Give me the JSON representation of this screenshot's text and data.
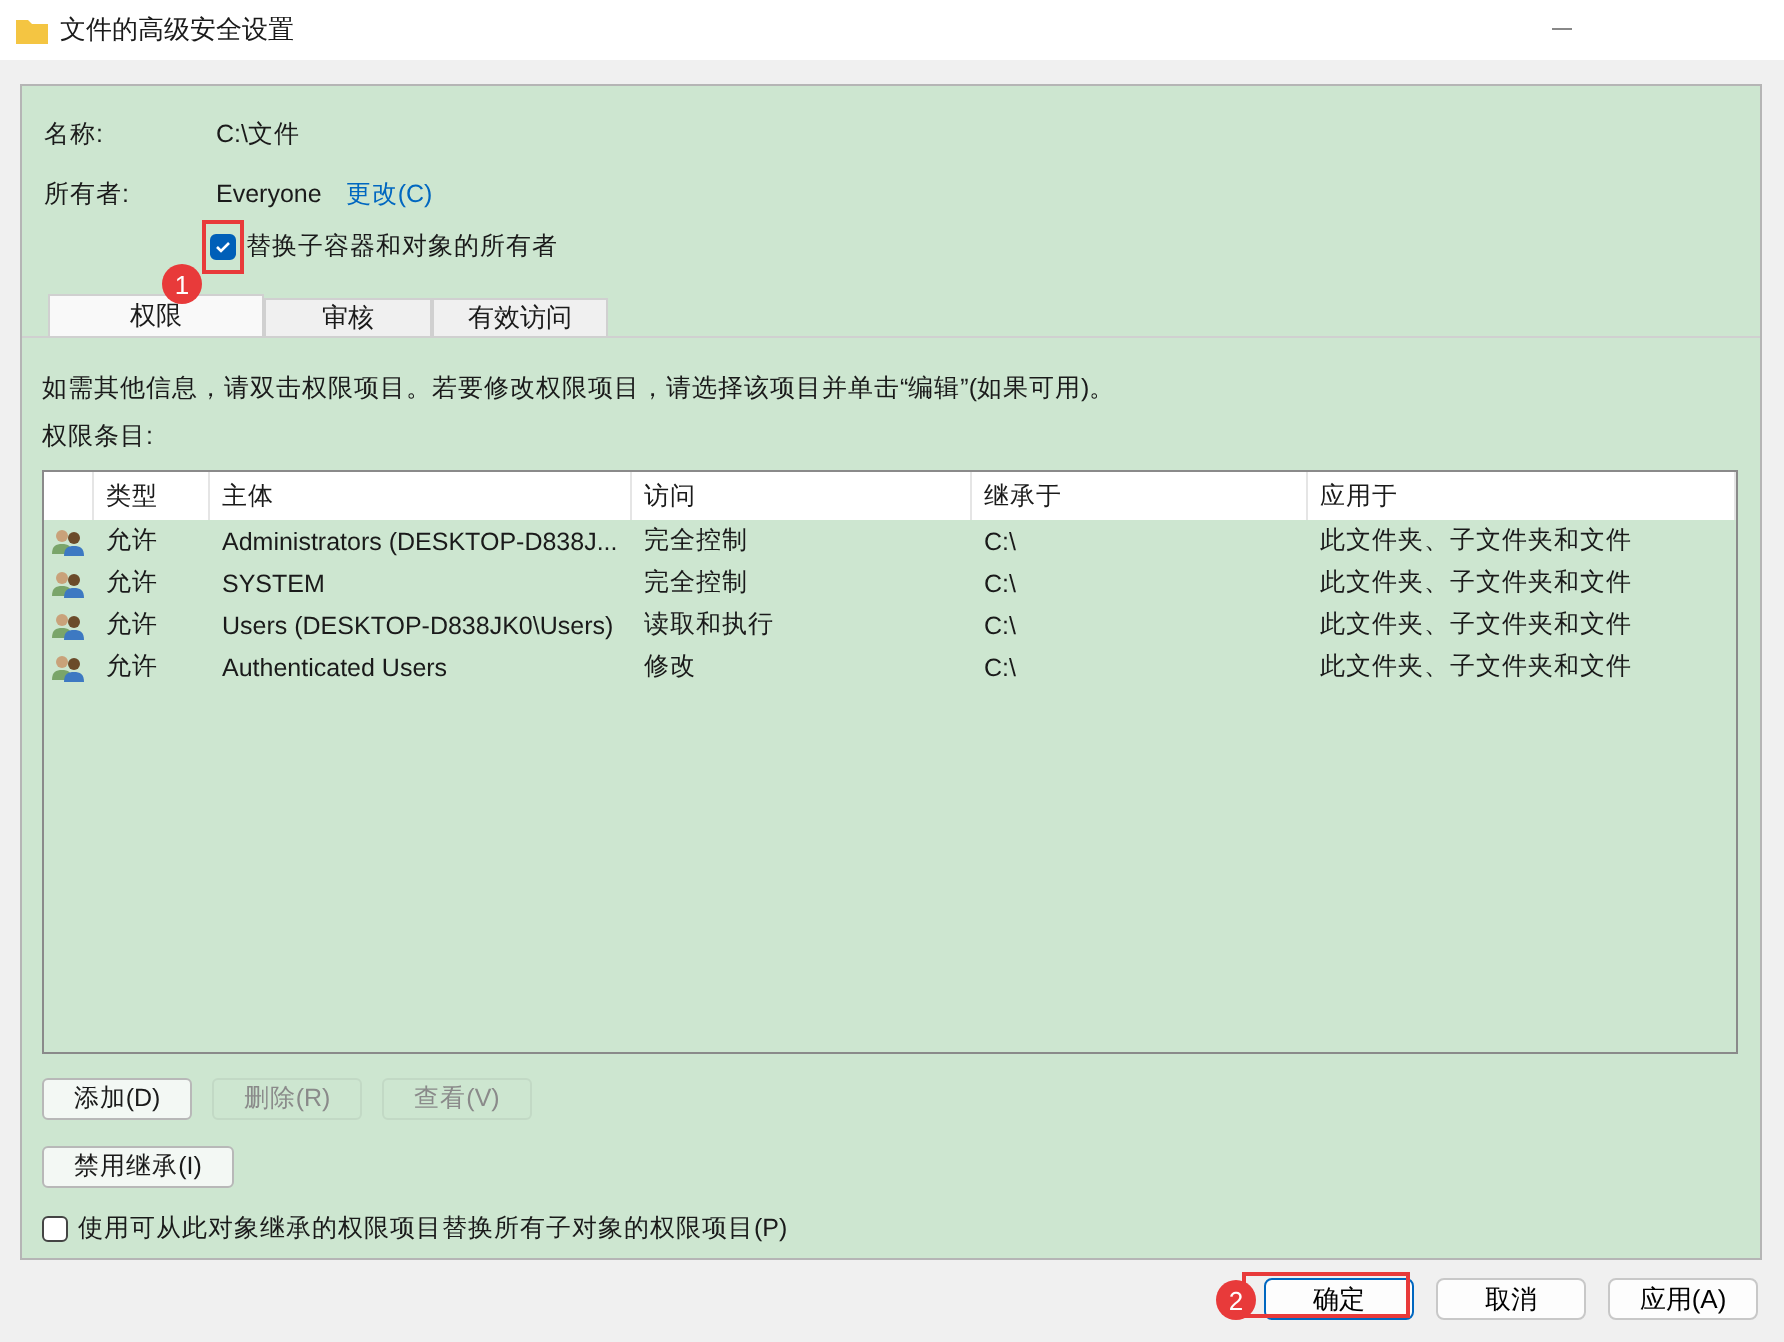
{
  "window": {
    "title": "文件的高级安全设置"
  },
  "name_row": {
    "label": "名称:",
    "value": "C:\\文件"
  },
  "owner_row": {
    "label": "所有者:",
    "value": "Everyone",
    "link": "更改(C)"
  },
  "replace_owner": {
    "label": "替换子容器和对象的所有者",
    "checked": true,
    "annotation": "1"
  },
  "tabs": [
    {
      "label": "权限",
      "selected": true
    },
    {
      "label": "审核",
      "selected": false
    },
    {
      "label": "有效访问",
      "selected": false
    }
  ],
  "description": "如需其他信息，请双击权限项目。若要修改权限项目，请选择该项目并单击“编辑”(如果可用)。",
  "entries_label": "权限条目:",
  "table": {
    "columns": [
      "类型",
      "主体",
      "访问",
      "继承于",
      "应用于"
    ],
    "rows": [
      {
        "type": "允许",
        "principal": "Administrators (DESKTOP-D838J...",
        "access": "完全控制",
        "inherited_from": "C:\\",
        "applies_to": "此文件夹、子文件夹和文件"
      },
      {
        "type": "允许",
        "principal": "SYSTEM",
        "access": "完全控制",
        "inherited_from": "C:\\",
        "applies_to": "此文件夹、子文件夹和文件"
      },
      {
        "type": "允许",
        "principal": "Users (DESKTOP-D838JK0\\Users)",
        "access": "读取和执行",
        "inherited_from": "C:\\",
        "applies_to": "此文件夹、子文件夹和文件"
      },
      {
        "type": "允许",
        "principal": "Authenticated Users",
        "access": "修改",
        "inherited_from": "C:\\",
        "applies_to": "此文件夹、子文件夹和文件"
      }
    ]
  },
  "entry_buttons": [
    {
      "label": "添加(D)",
      "disabled": false
    },
    {
      "label": "删除(R)",
      "disabled": true
    },
    {
      "label": "查看(V)",
      "disabled": true
    }
  ],
  "inheritance_button": {
    "label": "禁用继承(I)"
  },
  "replace_children": {
    "label": "使用可从此对象继承的权限项目替换所有子对象的权限项目(P)",
    "checked": false
  },
  "footer_buttons": [
    {
      "label": "确定",
      "default": true,
      "annotation": "2"
    },
    {
      "label": "取消",
      "default": false
    },
    {
      "label": "应用(A)",
      "default": false
    }
  ]
}
